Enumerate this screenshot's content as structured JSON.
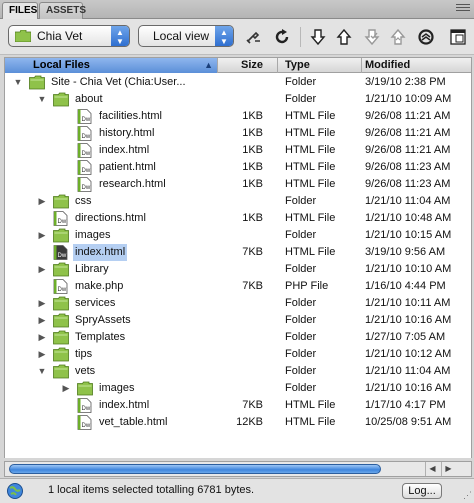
{
  "tabs": [
    {
      "label": "FILES",
      "active": true
    },
    {
      "label": "ASSETS",
      "active": false
    }
  ],
  "toolbar": {
    "site_select": "Chia Vet",
    "view_select": "Local view",
    "icons": [
      "connect-icon",
      "refresh-icon",
      "get-files-icon",
      "put-files-icon",
      "check-out-icon",
      "check-in-icon",
      "synchronize-icon",
      "expand-icon"
    ]
  },
  "columns": {
    "name": "Local Files",
    "size": "Size",
    "type": "Type",
    "modified": "Modified"
  },
  "rows": [
    {
      "name": "Site - Chia Vet (Chia:User...",
      "size": "",
      "type": "Folder",
      "modified": "3/19/10 2:38 PM",
      "kind": "site",
      "depth": 0,
      "expand": "open"
    },
    {
      "name": "about",
      "size": "",
      "type": "Folder",
      "modified": "1/21/10 10:09 AM",
      "kind": "folder",
      "depth": 1,
      "expand": "open"
    },
    {
      "name": "facilities.html",
      "size": "1KB",
      "type": "HTML File",
      "modified": "9/26/08 11:21 AM",
      "kind": "file",
      "depth": 2,
      "expand": ""
    },
    {
      "name": "history.html",
      "size": "1KB",
      "type": "HTML File",
      "modified": "9/26/08 11:21 AM",
      "kind": "file",
      "depth": 2,
      "expand": ""
    },
    {
      "name": "index.html",
      "size": "1KB",
      "type": "HTML File",
      "modified": "9/26/08 11:21 AM",
      "kind": "file",
      "depth": 2,
      "expand": ""
    },
    {
      "name": "patient.html",
      "size": "1KB",
      "type": "HTML File",
      "modified": "9/26/08 11:23 AM",
      "kind": "file",
      "depth": 2,
      "expand": ""
    },
    {
      "name": "research.html",
      "size": "1KB",
      "type": "HTML File",
      "modified": "9/26/08 11:23 AM",
      "kind": "file",
      "depth": 2,
      "expand": ""
    },
    {
      "name": "css",
      "size": "",
      "type": "Folder",
      "modified": "1/21/10 11:04 AM",
      "kind": "folder",
      "depth": 1,
      "expand": "closed"
    },
    {
      "name": "directions.html",
      "size": "1KB",
      "type": "HTML File",
      "modified": "1/21/10 10:48 AM",
      "kind": "file",
      "depth": 1,
      "expand": ""
    },
    {
      "name": "images",
      "size": "",
      "type": "Folder",
      "modified": "1/21/10 10:15 AM",
      "kind": "folder",
      "depth": 1,
      "expand": "closed"
    },
    {
      "name": "index.html",
      "size": "7KB",
      "type": "HTML File",
      "modified": "3/19/10 9:56 AM",
      "kind": "file-dark",
      "depth": 1,
      "expand": "",
      "selected": true
    },
    {
      "name": "Library",
      "size": "",
      "type": "Folder",
      "modified": "1/21/10 10:10 AM",
      "kind": "folder",
      "depth": 1,
      "expand": "closed"
    },
    {
      "name": "make.php",
      "size": "7KB",
      "type": "PHP File",
      "modified": "1/16/10 4:44 PM",
      "kind": "file",
      "depth": 1,
      "expand": ""
    },
    {
      "name": "services",
      "size": "",
      "type": "Folder",
      "modified": "1/21/10 10:11 AM",
      "kind": "folder",
      "depth": 1,
      "expand": "closed"
    },
    {
      "name": "SpryAssets",
      "size": "",
      "type": "Folder",
      "modified": "1/21/10 10:16 AM",
      "kind": "folder",
      "depth": 1,
      "expand": "closed"
    },
    {
      "name": "Templates",
      "size": "",
      "type": "Folder",
      "modified": "1/27/10 7:05 AM",
      "kind": "folder",
      "depth": 1,
      "expand": "closed"
    },
    {
      "name": "tips",
      "size": "",
      "type": "Folder",
      "modified": "1/21/10 10:12 AM",
      "kind": "folder",
      "depth": 1,
      "expand": "closed"
    },
    {
      "name": "vets",
      "size": "",
      "type": "Folder",
      "modified": "1/21/10 11:04 AM",
      "kind": "folder",
      "depth": 1,
      "expand": "open"
    },
    {
      "name": "images",
      "size": "",
      "type": "Folder",
      "modified": "1/21/10 10:16 AM",
      "kind": "folder",
      "depth": 2,
      "expand": "closed"
    },
    {
      "name": "index.html",
      "size": "7KB",
      "type": "HTML File",
      "modified": "1/17/10 4:17 PM",
      "kind": "file",
      "depth": 2,
      "expand": ""
    },
    {
      "name": "vet_table.html",
      "size": "12KB",
      "type": "HTML File",
      "modified": "10/25/08 9:51 AM",
      "kind": "file",
      "depth": 2,
      "expand": ""
    }
  ],
  "file_icon_label": "Dw",
  "status": {
    "message": "1 local items selected totalling 6781 bytes.",
    "log_button": "Log..."
  },
  "colors": {
    "selection": "#b5cff2",
    "folder": "#8fc24a",
    "scroll_thumb": "#3f86dd"
  }
}
